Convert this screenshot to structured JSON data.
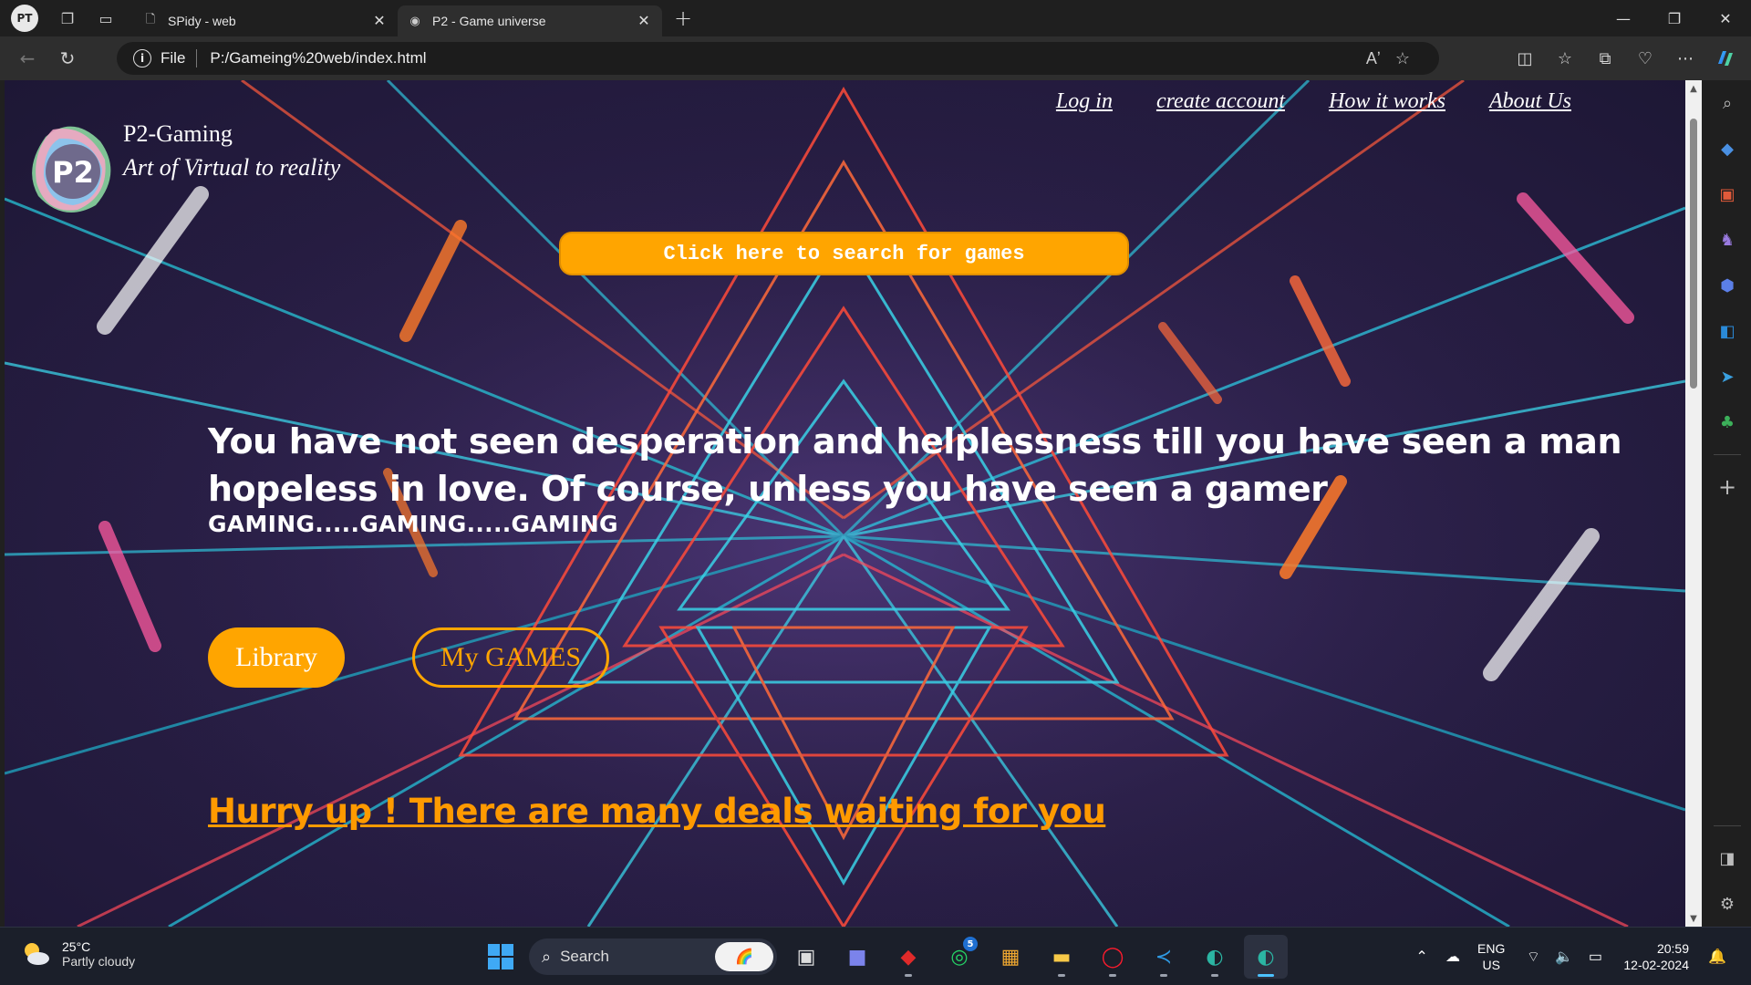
{
  "browser": {
    "profile_initials": "PT",
    "tabs": [
      {
        "title": "SPidy - web",
        "icon": "document-icon",
        "active": false
      },
      {
        "title": "P2 - Game universe",
        "icon": "p2-favicon",
        "active": true
      }
    ],
    "address": {
      "scheme_label": "File",
      "url": "P:/Gameing%20web/index.html"
    }
  },
  "site": {
    "brand_name": "P2-Gaming",
    "tagline": "Art of Virtual to reality",
    "nav": [
      "Log in",
      "create account",
      "How it works",
      "About Us"
    ],
    "search_button": "Click here to search for games",
    "quote": "You have not seen desperation and helplessness till you have seen a man hopeless in love. Of course, unless you have seen a gamer",
    "gaming_line": "GAMING.....GAMING.....GAMING",
    "library_button": "Library",
    "mygames_button": "My GAMES",
    "deals_link": "Hurry up ! There are many deals waiting for you",
    "colors": {
      "accent": "#ffa500",
      "deals": "#ff9a00",
      "text": "#ffffff"
    }
  },
  "taskbar": {
    "weather": {
      "temp": "25°C",
      "condition": "Partly cloudy"
    },
    "search_label": "Search",
    "whatsapp_badge": "5",
    "language": {
      "line1": "ENG",
      "line2": "US"
    },
    "clock": {
      "time": "20:59",
      "date": "12-02-2024"
    }
  }
}
